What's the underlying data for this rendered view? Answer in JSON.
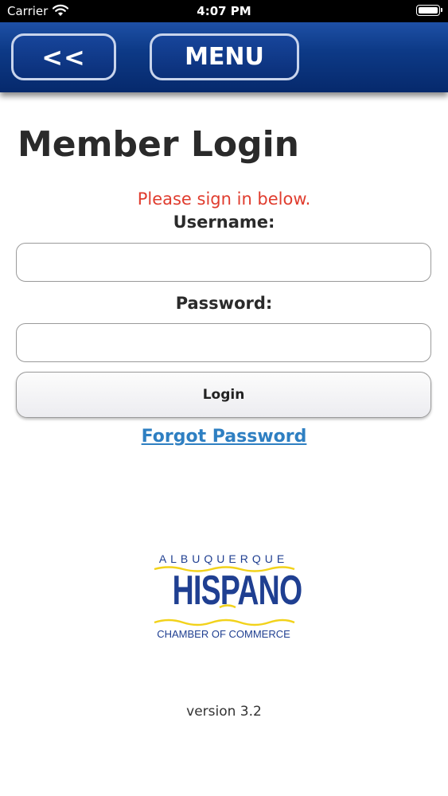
{
  "status_bar": {
    "carrier": "Carrier",
    "time": "4:07 PM",
    "wifi_icon": "wifi-icon",
    "battery_icon": "battery-icon",
    "battery_level": 1.0
  },
  "nav": {
    "back_label": "<<",
    "menu_label": "MENU"
  },
  "page": {
    "title": "Member Login",
    "prompt": "Please sign in below.",
    "username_label": "Username:",
    "username_value": "",
    "password_label": "Password:",
    "password_value": "",
    "login_label": "Login",
    "forgot_password": "Forgot Password"
  },
  "logo": {
    "top_text": "ALBUQUERQUE",
    "main_text": "HISPANO",
    "bottom_text": "CHAMBER OF COMMERCE"
  },
  "footer": {
    "version": "version 3.2"
  },
  "colors": {
    "nav_bar": "#0d3a87",
    "prompt_text": "#e03c2e",
    "link": "#2e7fc2",
    "logo_blue": "#1f3f91",
    "logo_yellow": "#f2d21a"
  }
}
